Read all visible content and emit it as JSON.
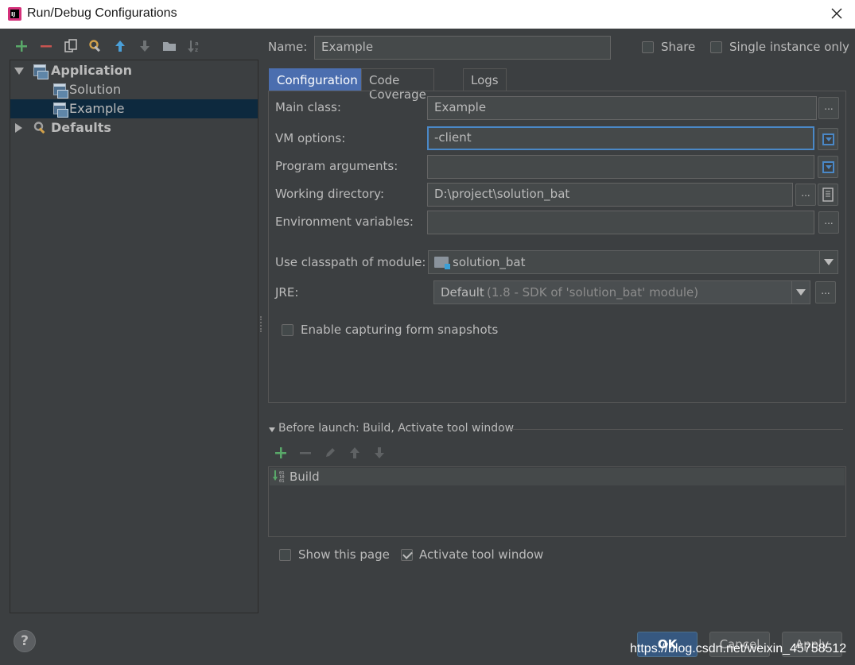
{
  "window": {
    "title": "Run/Debug Configurations"
  },
  "toolbar": {
    "icons": [
      "add-icon",
      "remove-icon",
      "copy-icon",
      "edit-defaults-icon",
      "move-up-icon",
      "move-down-icon",
      "folder-icon",
      "sort-icon"
    ]
  },
  "tree": {
    "items": [
      {
        "label": "Application",
        "expanded": true,
        "children": [
          {
            "label": "Solution"
          },
          {
            "label": "Example",
            "selected": true
          }
        ]
      },
      {
        "label": "Defaults",
        "expanded": false
      }
    ]
  },
  "header": {
    "name_label": "Name:",
    "name_value": "Example",
    "share_label": "Share",
    "share_checked": false,
    "single_instance_label": "Single instance only",
    "single_instance_checked": false
  },
  "tabs": [
    {
      "label": "Configuration",
      "active": true
    },
    {
      "label": "Code Coverage"
    },
    {
      "label": "Logs"
    }
  ],
  "config": {
    "main_class_label": "Main class:",
    "main_class_value": "Example",
    "vm_options_label": "VM options:",
    "vm_options_value": "-client",
    "program_args_label": "Program arguments:",
    "program_args_value": "",
    "working_dir_label": "Working directory:",
    "working_dir_value": "D:\\project\\solution_bat",
    "env_vars_label": "Environment variables:",
    "env_vars_value": "",
    "classpath_label": "Use classpath of module:",
    "classpath_value": "solution_bat",
    "jre_label": "JRE:",
    "jre_value": "Default",
    "jre_hint": "(1.8 - SDK of 'solution_bat' module)",
    "snapshots_label": "Enable capturing form snapshots",
    "snapshots_checked": false,
    "ellipsis": "..."
  },
  "before_launch": {
    "title": "Before launch: Build, Activate tool window",
    "items": [
      {
        "label": "Build"
      }
    ]
  },
  "footer": {
    "show_page_label": "Show this page",
    "show_page_checked": false,
    "activate_label": "Activate tool window",
    "activate_checked": true,
    "help": "?",
    "ok": "OK",
    "cancel": "Cancel",
    "apply": "Apply"
  },
  "watermark": "https://blog.csdn.net/weixin_45758512",
  "colors": {
    "accent": "#4b6eaf",
    "selection": "#0d293e",
    "background": "#3c3f41",
    "add_green": "#59a869",
    "remove_red": "#c75450",
    "arrow_blue": "#4a9fd8"
  }
}
